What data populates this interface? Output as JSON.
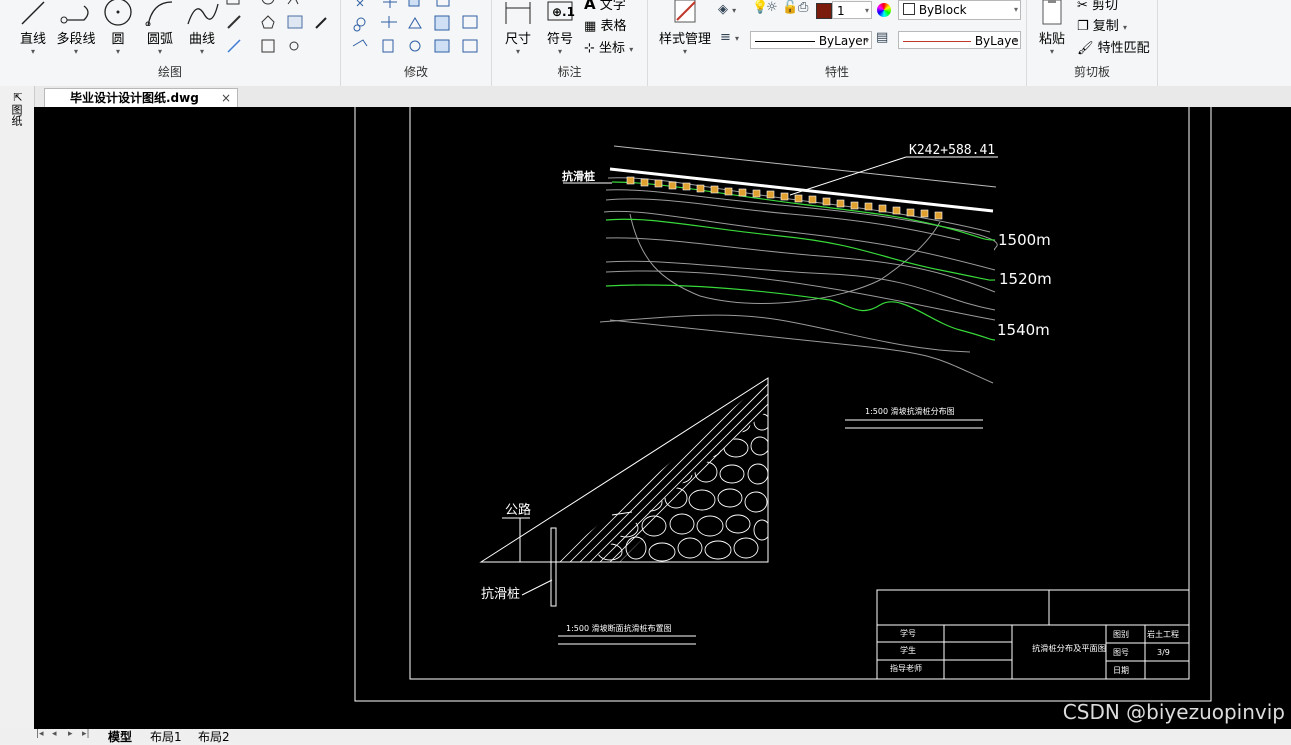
{
  "ribbon": {
    "draw": {
      "label": "绘图",
      "line": "直线",
      "polyline": "多段线",
      "circle": "圆",
      "arc": "圆弧",
      "curve": "曲线"
    },
    "modify": {
      "label": "修改"
    },
    "annotate": {
      "label": "标注",
      "dimension": "尺寸",
      "symbol": "符号",
      "text": "文字",
      "table": "表格",
      "coordinate": "坐标"
    },
    "properties": {
      "label": "特性",
      "style_manager": "样式管理",
      "color_value": "1",
      "byblock": "ByBlock",
      "linetype": "ByLayer",
      "lineweight": "ByLaye"
    },
    "clipboard": {
      "label": "剪切板",
      "paste": "粘贴",
      "cut": "剪切",
      "copy": "复制",
      "match": "特性匹配"
    }
  },
  "tabs": {
    "document": "毕业设计设计图纸.dwg",
    "close": "×",
    "side_label": "图纸"
  },
  "layout_tabs": [
    "模型",
    "布局1",
    "布局2"
  ],
  "drawing": {
    "station_label": "K242+588.41",
    "pile_label_top": "抗滑桩",
    "contour_labels": [
      "1500m",
      "1520m",
      "1540m"
    ],
    "plan_title": "1:500 滑坡抗滑桩分布图",
    "road_label": "公路",
    "pile_label": "抗滑桩",
    "section_title": "1:500 滑坡断面抗滑桩布置图",
    "title_block": {
      "student_no": "学号",
      "student": "学生",
      "advisor": "指导老师",
      "drawing_name": "抗滑桩分布及平面图",
      "category_label": "图别",
      "category_value": "岩土工程",
      "number_label": "图号",
      "number_value": "3/9",
      "date_label": "日期"
    }
  },
  "watermark": "CSDN @biyezuopinvip",
  "colors": {
    "canvas": "#000000",
    "contour_green": "#38d83a",
    "line_white": "#ffffff",
    "line_gray": "#9a9a9a",
    "hatch_orange": "#e0a030",
    "color_swatch": "#7a1b0c"
  }
}
